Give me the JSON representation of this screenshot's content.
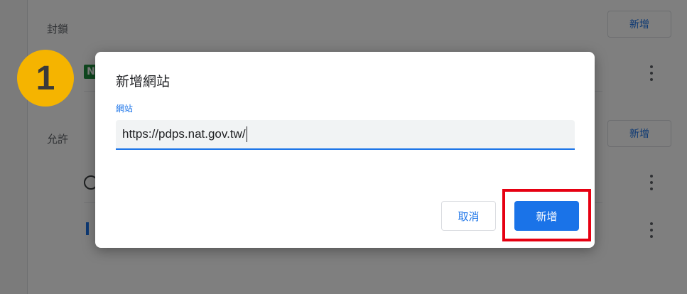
{
  "background": {
    "block_section_label": "封鎖",
    "allow_section_label": "允許",
    "add_button_label": "新增",
    "site_icons": [
      "n-badge-icon",
      "globe-icon",
      "i-bar-icon"
    ]
  },
  "step_badge": {
    "number": "1",
    "color": "#f5b400"
  },
  "dialog": {
    "title": "新增網站",
    "field_label": "網站",
    "url_value": "https://pdps.nat.gov.tw/",
    "cancel_label": "取消",
    "confirm_label": "新增"
  },
  "colors": {
    "accent": "#1a73e8",
    "highlight": "#e60012"
  }
}
